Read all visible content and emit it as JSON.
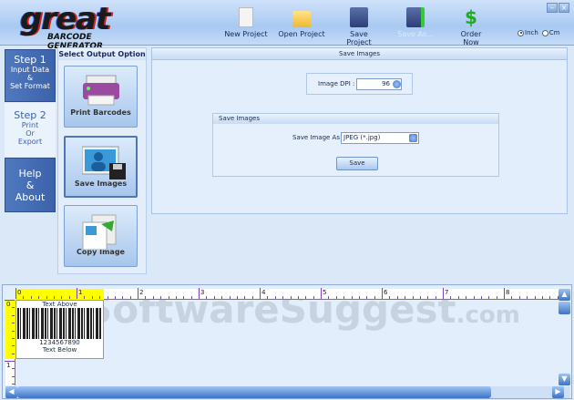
{
  "logo": {
    "word": "great",
    "subtitle": "BARCODE GENERATOR"
  },
  "toolbar": [
    {
      "label": "New  Project",
      "icon": "new-project-icon"
    },
    {
      "label": "Open  Project",
      "icon": "folder-icon"
    },
    {
      "label": "Save Project",
      "icon": "floppy-icon"
    },
    {
      "label": "Save As...",
      "icon": "save-as-icon",
      "disabled": true
    },
    {
      "label": "Order Now",
      "icon": "dollar-icon"
    }
  ],
  "units": {
    "inch": "Inch",
    "cm": "Cm",
    "selected": "Inch"
  },
  "steps": [
    {
      "title": "Step 1",
      "line1": "Input Data",
      "line2": "&",
      "line3": "Set Format"
    },
    {
      "title": "Step 2",
      "line1": "Print",
      "line2": "Or",
      "line3": "Export"
    },
    {
      "title": "Help",
      "line1": "&",
      "line2": "About"
    }
  ],
  "options": {
    "header": "Select Output Option",
    "items": [
      "Print Barcodes",
      "Save Images",
      "Copy Image"
    ],
    "selected": "Save Images"
  },
  "main": {
    "header": "Save Images",
    "dpi_label": "Image DPI :",
    "dpi_value": "96",
    "group_title": "Save Images",
    "format_label": "Save Image As :",
    "format_value": "JPEG  (*.jpg)",
    "save_label": "Save"
  },
  "canvas": {
    "ruler_numbers": [
      "0",
      "1",
      "2",
      "3",
      "4",
      "5",
      "6",
      "7",
      "8"
    ],
    "vruler_numbers": [
      "0",
      "1"
    ],
    "text_above": "Text Above",
    "barcode_value": "1234567890",
    "text_below": "Text Below"
  },
  "watermark": {
    "main": "SoftwareSuggest",
    "suffix": ".com"
  },
  "colors": {
    "accent": "#3c62aa",
    "highlight": "#ffff00"
  }
}
